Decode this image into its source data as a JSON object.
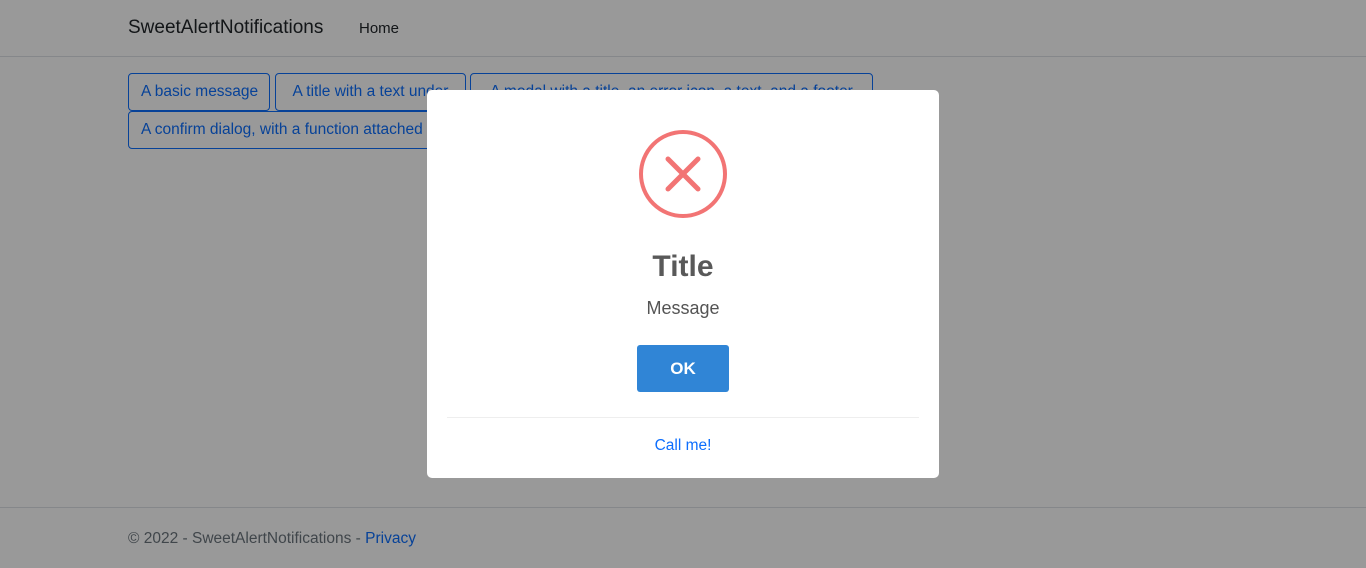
{
  "navbar": {
    "brand": "SweetAlertNotifications",
    "links": [
      "Home"
    ]
  },
  "buttons": [
    "A basic message",
    "A title with a text under",
    "A modal with a title, an error icon, a text, and a footer",
    "A confirm dialog, with a function attached to the 'Confirm'-button"
  ],
  "footer": {
    "text": "© 2022 - SweetAlertNotifications - ",
    "privacy_link": "Privacy"
  },
  "modal": {
    "icon": "error-x-icon",
    "title": "Title",
    "text": "Message",
    "confirm_label": "OK",
    "footer_link": "Call me!"
  },
  "colors": {
    "primary": "#0d6efd",
    "confirm_button": "#3085d6",
    "error_icon": "#f27474",
    "overlay": "rgba(0,0,0,0.4)"
  }
}
